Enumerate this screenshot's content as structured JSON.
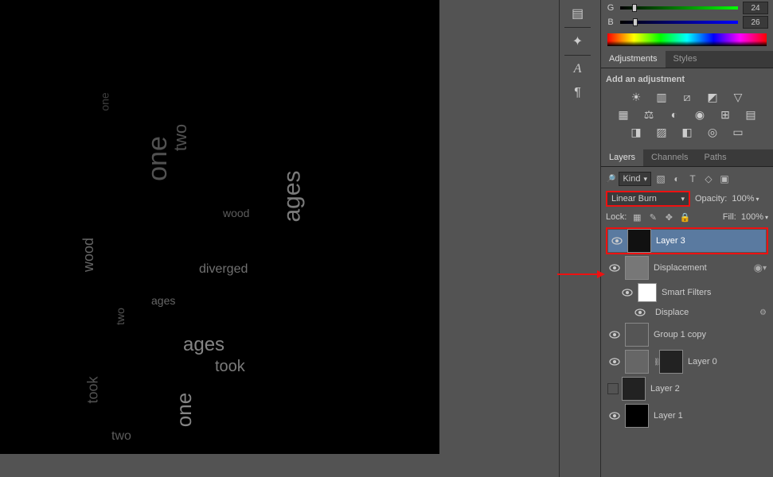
{
  "color_panel": {
    "g_label": "G",
    "g_value": "24",
    "b_label": "B",
    "b_value": "26"
  },
  "adjustments": {
    "tab_adjustments": "Adjustments",
    "tab_styles": "Styles",
    "title": "Add an adjustment",
    "icons_row1": [
      "brightness-icon",
      "levels-icon",
      "curves-icon",
      "exposure-icon",
      "vibrance-icon"
    ],
    "icons_row2": [
      "hue-icon",
      "balance-icon",
      "bw-icon",
      "photo-filter-icon",
      "channel-mixer-icon",
      "lut-icon"
    ],
    "icons_row3": [
      "invert-icon",
      "posterize-icon",
      "threshold-icon",
      "selective-icon",
      "gradient-map-icon"
    ]
  },
  "layers_panel": {
    "tabs": {
      "layers": "Layers",
      "channels": "Channels",
      "paths": "Paths"
    },
    "filter_kind_label": "Kind",
    "blend_mode": "Linear Burn",
    "opacity_label": "Opacity:",
    "opacity_value": "100%",
    "lock_label": "Lock:",
    "fill_label": "Fill:",
    "fill_value": "100%",
    "layers": [
      {
        "name": "Layer 3",
        "selected": true
      },
      {
        "name": "Displacement"
      },
      {
        "name": "Smart Filters",
        "sublabel": true
      },
      {
        "name": "Displace",
        "filter_item": true
      },
      {
        "name": "Group 1 copy"
      },
      {
        "name": "Layer 0"
      },
      {
        "name": "Layer 2"
      },
      {
        "name": "Layer 1"
      }
    ]
  },
  "canvas_words": [
    "one",
    "two",
    "wood",
    "ages",
    "took",
    "diverged",
    "one",
    "two",
    "ages",
    "one",
    "two",
    "wood",
    "ages",
    "took"
  ]
}
